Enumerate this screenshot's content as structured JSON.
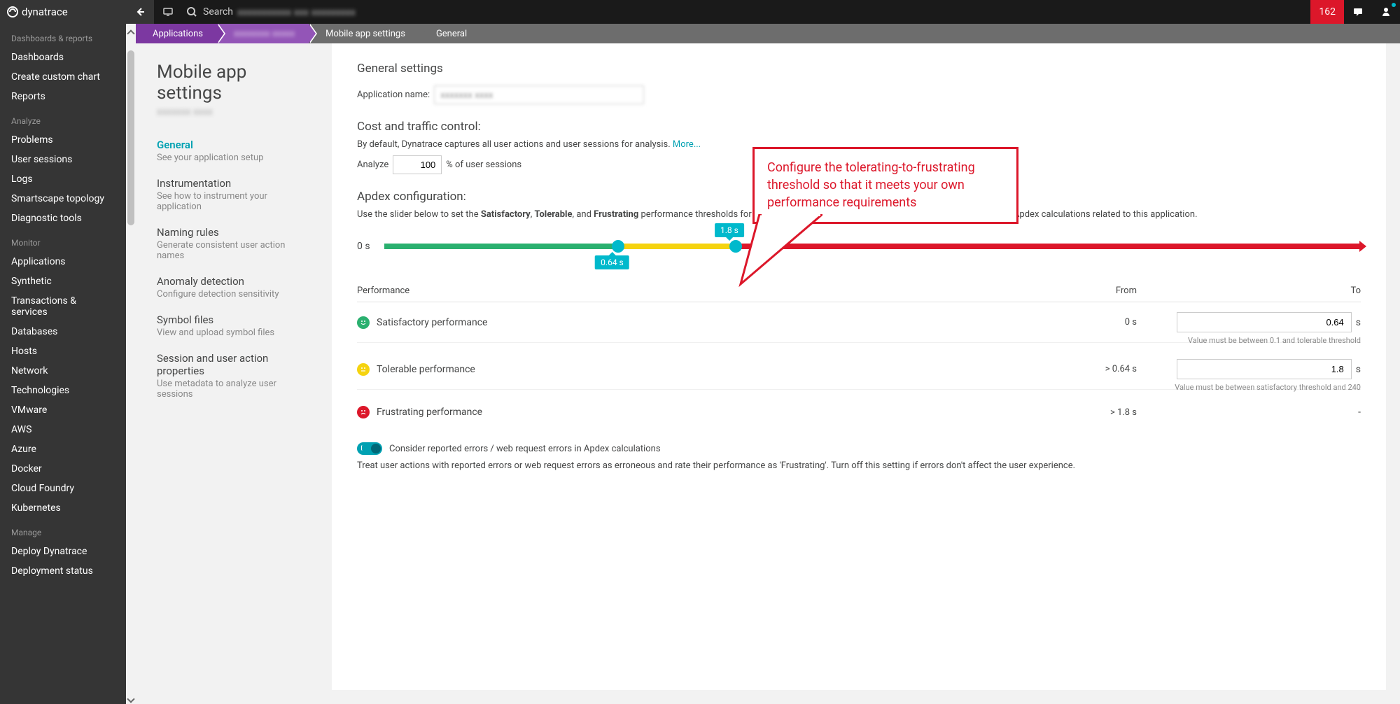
{
  "brand": "dynatrace",
  "topbar": {
    "search_label": "Search",
    "search_value": "xxxxxxxxxxx xxx xxxxxxxxx",
    "badge": "162"
  },
  "sidebar": {
    "sections": [
      {
        "label": "Dashboards & reports",
        "items": [
          "Dashboards",
          "Create custom chart",
          "Reports"
        ]
      },
      {
        "label": "Analyze",
        "items": [
          "Problems",
          "User sessions",
          "Logs",
          "Smartscape topology",
          "Diagnostic tools"
        ]
      },
      {
        "label": "Monitor",
        "items": [
          "Applications",
          "Synthetic",
          "Transactions & services",
          "Databases",
          "Hosts",
          "Network",
          "Technologies",
          "VMware",
          "AWS",
          "Azure",
          "Docker",
          "Cloud Foundry",
          "Kubernetes"
        ]
      },
      {
        "label": "Manage",
        "items": [
          "Deploy Dynatrace",
          "Deployment status"
        ]
      }
    ]
  },
  "breadcrumbs": {
    "b1": "Applications",
    "b2": "xxxxxxxx xxxxx",
    "b3": "Mobile app settings",
    "b4": "General"
  },
  "settings_sidebar": {
    "title": "Mobile app settings",
    "subtitle": "xxxxxxx xxxx",
    "items": [
      {
        "title": "General",
        "desc": "See your application setup",
        "active": true
      },
      {
        "title": "Instrumentation",
        "desc": "See how to instrument your application"
      },
      {
        "title": "Naming rules",
        "desc": "Generate consistent user action names"
      },
      {
        "title": "Anomaly detection",
        "desc": "Configure detection sensitivity"
      },
      {
        "title": "Symbol files",
        "desc": "View and upload symbol files"
      },
      {
        "title": "Session and user action properties",
        "desc": "Use metadata to analyze user sessions"
      }
    ]
  },
  "main": {
    "general_title": "General settings",
    "app_name_label": "Application name:",
    "app_name_value": "xxxxxxx xxxx",
    "cost_title": "Cost and traffic control:",
    "cost_desc": "By default, Dynatrace captures all user actions and user sessions for analysis. ",
    "more_link": "More...",
    "analyze_label": "Analyze",
    "analyze_value": "100",
    "analyze_suffix": "% of user sessions",
    "apdex_title": "Apdex configuration:",
    "apdex_desc_pre": "Use the slider below to set the ",
    "apdex_bold1": "Satisfactory",
    "apdex_bold2": "Tolerable",
    "apdex_bold3": "Frustrating",
    "apdex_desc_post": " performance thresholds for this key performance metric. These thresholds are also used for Apdex calculations related to this application.",
    "slider_start": "0 s",
    "handle1_label": "0.64 s",
    "handle2_label": "1.8 s",
    "perf_h1": "Performance",
    "perf_h2": "From",
    "perf_h3": "To",
    "satisfactory_label": "Satisfactory performance",
    "satisfactory_from": "0 s",
    "satisfactory_to": "0.64",
    "satisfactory_hint": "Value must be between 0.1 and tolerable threshold",
    "tolerable_label": "Tolerable performance",
    "tolerable_from": "> 0.64 s",
    "tolerable_to": "1.8",
    "tolerable_hint": "Value must be between satisfactory threshold and 240",
    "frustrating_label": "Frustrating performance",
    "frustrating_from": "> 1.8 s",
    "frustrating_to": "-",
    "unit_s": "s",
    "toggle_label": "Consider reported errors / web request errors in Apdex calculations",
    "toggle_desc": "Treat user actions with reported errors or web request errors as erroneous and rate their performance as 'Frustrating'. Turn off this setting if errors don't affect the user experience."
  },
  "callout": "Configure the tolerating-to-frustrating threshold so that it meets your own performance requirements"
}
